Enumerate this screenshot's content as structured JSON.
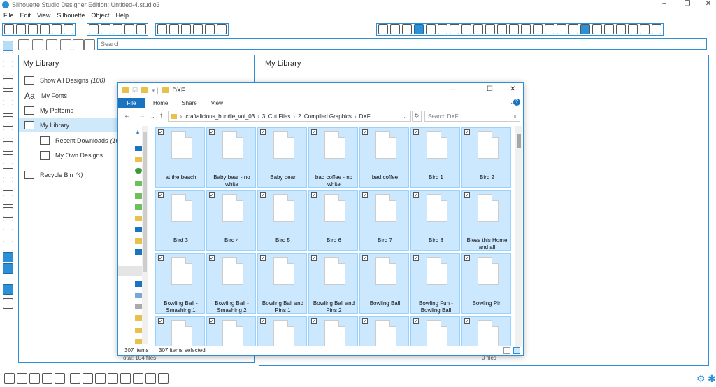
{
  "window": {
    "title": "Silhouette Studio Designer Edition: Untitled-4.studio3",
    "controls": [
      "–",
      "❐",
      "✕"
    ]
  },
  "menu": [
    "File",
    "Edit",
    "View",
    "Silhouette",
    "Object",
    "Help"
  ],
  "search": {
    "placeholder": "Search"
  },
  "library": {
    "heading": "My Library",
    "items": [
      {
        "label": "Show All Designs",
        "count": "(100)",
        "icon": "grid-icon"
      },
      {
        "label": "My Fonts",
        "count": "",
        "icon": "font-icon"
      },
      {
        "label": "My Patterns",
        "count": "",
        "icon": "folder-icon"
      },
      {
        "label": "My Library",
        "count": "",
        "icon": "folder-icon"
      },
      {
        "label": "Recent Downloads",
        "count": "(100)",
        "icon": "folder-icon"
      },
      {
        "label": "My Own Designs",
        "count": "",
        "icon": "folder-icon"
      },
      {
        "label": "Recycle Bin",
        "count": "(4)",
        "icon": "trash-icon"
      }
    ],
    "total": "Total: 104 files"
  },
  "right_panel": {
    "heading": "My Library",
    "total": "0 files"
  },
  "explorer": {
    "title": "DXF",
    "ribbon": {
      "file": "File",
      "tabs": [
        "Home",
        "Share",
        "View"
      ]
    },
    "path": [
      "craftalicious_bundle_vol_03",
      "3. Cut Files",
      "2. Compiled Graphics",
      "DXF"
    ],
    "search_placeholder": "Search DXF",
    "files": [
      "at the beach",
      "Baby bear - no white",
      "Baby bear",
      "bad coffee - no white",
      "bad coffee",
      "Bird 1",
      "Bird 2",
      "Bird 3",
      "Bird 4",
      "Bird 5",
      "Bird 6",
      "Bird 7",
      "Bird 8",
      "Bless this Home and all",
      "Bowling Ball - Smashing 1",
      "Bowling Ball - Smashing 2",
      "Bowling Ball and Pins 1",
      "Bowling Ball and Pins 2",
      "Bowling Ball",
      "Bowling Fun - Bowling Ball",
      "Bowling Pin",
      "",
      "",
      "",
      "",
      "",
      "",
      ""
    ],
    "status": {
      "count": "307 items",
      "selected": "307 items selected"
    }
  },
  "colors": {
    "accent": "#2d8fd5",
    "selection": "#cce8ff"
  }
}
